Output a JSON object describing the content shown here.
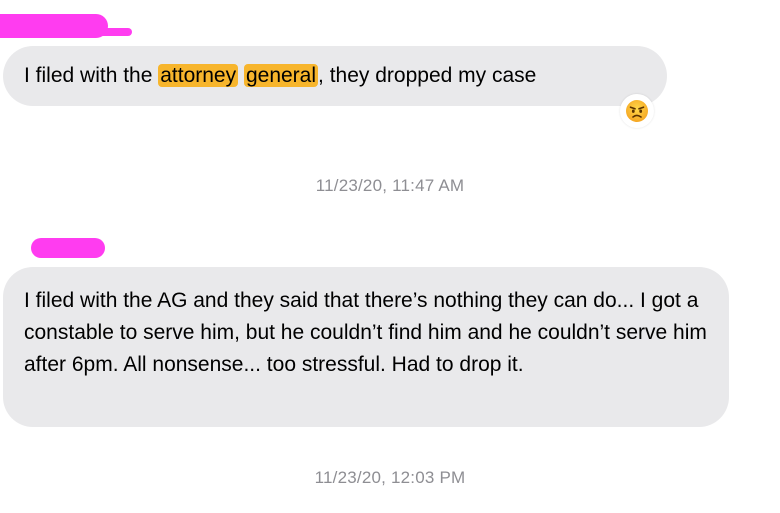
{
  "messages": [
    {
      "parts": [
        "I filed with the ",
        "attorney",
        " ",
        "general",
        ", they dropped my case"
      ],
      "reaction": "angry-face-emoji",
      "timestamp": "11/23/20, 11:47 AM"
    },
    {
      "text": "I filed with the AG and they said that there’s nothing they can do... I got a constable to serve  him, but he couldn’t find him and he couldn’t serve him after 6pm. All nonsense... too stressful. Had to drop it.",
      "timestamp": "11/23/20, 12:03 PM"
    }
  ],
  "colors": {
    "bubble_bg": "#e9e9eb",
    "highlight": "#f7b52c",
    "redaction": "#ff3cf0",
    "timestamp": "#8e8e93"
  },
  "icons": {
    "reaction": "angry-face-emoji"
  }
}
